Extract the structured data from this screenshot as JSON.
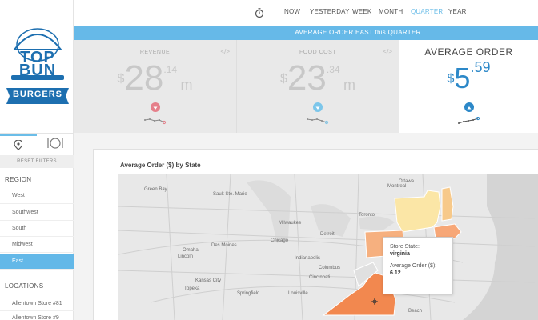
{
  "brand": {
    "line1": "TOP",
    "line2": "BUN",
    "banner": "BURGERS"
  },
  "nav": {
    "items": [
      {
        "label": "NOW"
      },
      {
        "label": "YESTERDAY"
      },
      {
        "label": "WEEK"
      },
      {
        "label": "MONTH"
      },
      {
        "label": "QUARTER",
        "active": true
      },
      {
        "label": "YEAR"
      }
    ],
    "clock_icon": "stopwatch-icon"
  },
  "banner": "AVERAGE ORDER EAST this QUARTER",
  "kpis": [
    {
      "label": "REVENUE",
      "currency": "$",
      "whole": "28",
      "decimal": ".14",
      "unit": "m",
      "trend": "down",
      "trend_color": "#e57f8a"
    },
    {
      "label": "FOOD COST",
      "currency": "$",
      "whole": "23",
      "decimal": ".34",
      "unit": "m",
      "trend": "down",
      "trend_color": "#7cc6ea"
    },
    {
      "label": "AVERAGE ORDER",
      "currency": "$",
      "whole": "5",
      "decimal": ".59",
      "unit": "",
      "trend": "up",
      "trend_color": "#2c88c8"
    }
  ],
  "sidebar": {
    "reset_label": "RESET FILTERS",
    "region_title": "REGION",
    "regions": [
      "West",
      "Southwest",
      "South",
      "Midwest",
      "East"
    ],
    "active_region": "East",
    "locations_title": "LOCATIONS",
    "locations": [
      "Allentown Store #81",
      "Allentown Store #9"
    ]
  },
  "map": {
    "title": "Average Order ($) by State",
    "cities": [
      "Sault Ste. Marie",
      "Green Bay",
      "Milwaukee",
      "Chicago",
      "Detroit",
      "Toronto",
      "Montreal",
      "Ottawa",
      "Des Moines",
      "Omaha",
      "Lincoln",
      "Indianapolis",
      "Columbus",
      "Cincinnati",
      "Kansas City",
      "Topeka",
      "Louisville",
      "Springfield",
      "Beach"
    ],
    "tooltip": {
      "label1": "Store State:",
      "value1": "virginia",
      "label2": "Average Order ($):",
      "value2": "6.12"
    },
    "colors": {
      "virginia": "#f2884f",
      "pennsylvania": "#f6b07f",
      "newyork": "#fbe6a6",
      "newhampshire": "#f7c98a",
      "massachusetts": "#f7a777",
      "highlight_blue": "#66b9e8"
    }
  }
}
